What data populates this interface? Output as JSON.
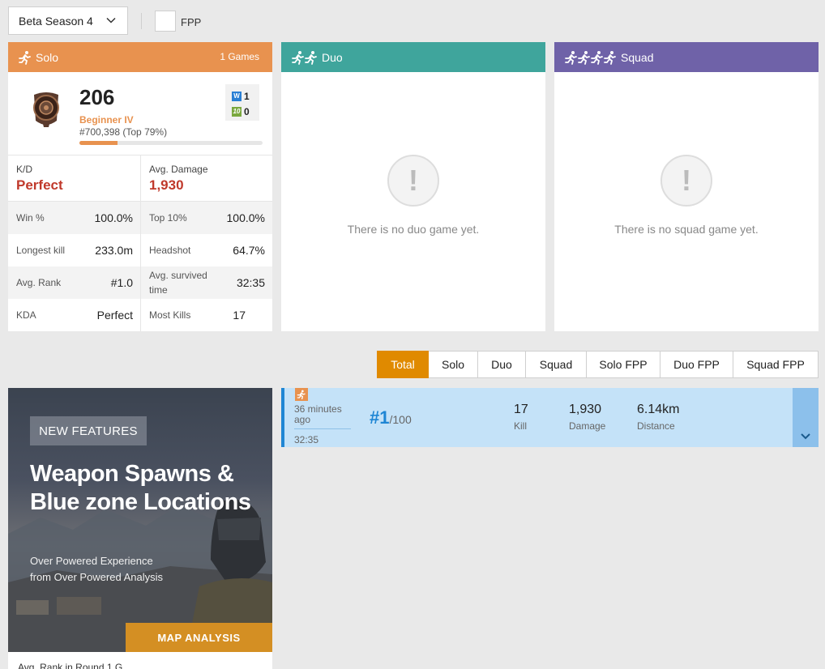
{
  "filters": {
    "season": "Beta Season 4",
    "fpp_label": "FPP"
  },
  "solo": {
    "title": "Solo",
    "games": "1 Games",
    "rating": "206",
    "tier": "Beginner IV",
    "rank": "#700,398 (Top 79%)",
    "rank_progress_percent": 21,
    "wins": "1",
    "top10": "0",
    "badge_w": "W",
    "badge_10": "10",
    "kd_label": "K/D",
    "kd_value": "Perfect",
    "avg_damage_label": "Avg. Damage",
    "avg_damage_value": "1,930",
    "rows": [
      {
        "l1": "Win %",
        "v1": "100.0%",
        "l2": "Top 10%",
        "v2": "100.0%"
      },
      {
        "l1": "Longest kill",
        "v1": "233.0m",
        "l2": "Headshot",
        "v2": "64.7%"
      },
      {
        "l1": "Avg. Rank",
        "v1": "#1.0",
        "l2": "Avg. survived time",
        "v2": "32:35"
      },
      {
        "l1": "KDA",
        "v1": "Perfect",
        "l2": "Most Kills",
        "v2": "17"
      }
    ]
  },
  "duo": {
    "title": "Duo",
    "empty_text": "There is no duo game yet."
  },
  "squad": {
    "title": "Squad",
    "empty_text": "There is no squad game yet."
  },
  "empty_icon": "!",
  "mode_tabs": [
    "Total",
    "Solo",
    "Duo",
    "Squad",
    "Solo FPP",
    "Duo FPP",
    "Squad FPP"
  ],
  "ad": {
    "tag": "NEW FEATURES",
    "title": "Weapon Spawns & Blue zone Locations",
    "subtitle_1": "Over Powered Experience",
    "subtitle_2": "from Over Powered Analysis",
    "cta": "MAP ANALYSIS",
    "caption": "Avg. Rank in Round 1 G..."
  },
  "match": {
    "ago": "36 minutes ago",
    "duration": "32:35",
    "place": "#1",
    "total": "/100",
    "kills_value": "17",
    "kills_label": "Kill",
    "damage_value": "1,930",
    "damage_label": "Damage",
    "distance_value": "6.14km",
    "distance_label": "Distance"
  },
  "colors": {
    "solo": "#e8924f",
    "duo": "#3fa59c",
    "squad": "#6f62a8",
    "active_tab": "#e08a00",
    "accent_red": "#c0392b",
    "match_blue": "#1f86d4"
  }
}
